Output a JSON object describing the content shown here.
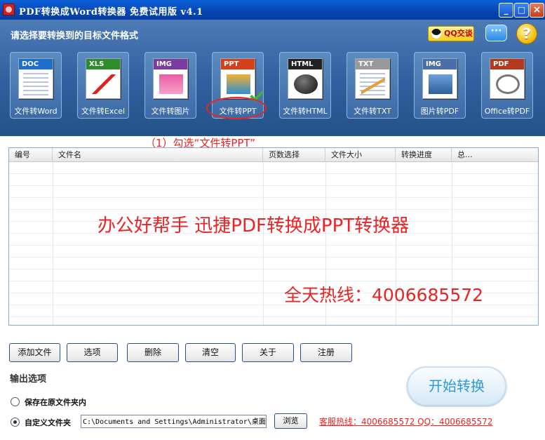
{
  "window": {
    "title": "PDF转换成Word转换器 免费试用版 v4.1",
    "minimize": "_",
    "maximize": "□",
    "close": "×"
  },
  "topbar": {
    "prompt": "请选择要转换到的目标文件格式",
    "qq_label": "QQ交谈",
    "chat_glyph": "···",
    "help_glyph": "?"
  },
  "formats": [
    {
      "tag": "DOC",
      "label": "文件转Word"
    },
    {
      "tag": "XLS",
      "label": "文件转Excel"
    },
    {
      "tag": "IMG",
      "label": "文件转图片"
    },
    {
      "tag": "PPT",
      "label": "文件转PPT"
    },
    {
      "tag": "HTML",
      "label": "文件转HTML"
    },
    {
      "tag": "TXT",
      "label": "文件转TXT"
    },
    {
      "tag": "IMG",
      "label": "图片转PDF"
    },
    {
      "tag": "PDF",
      "label": "Office转PDF"
    }
  ],
  "annotation": "（1）勾选“文件转PPT”",
  "file_list": {
    "columns": [
      "编号",
      "文件名",
      "页数选择",
      "文件大小",
      "转换进度",
      "总..."
    ],
    "watermark": "办公好帮手  迅捷PDF转换成PPT转换器",
    "hotline": "全天热线：4006685572"
  },
  "buttons": {
    "add": "添加文件",
    "options": "选项",
    "delete": "删除",
    "clear": "清空",
    "about": "关于",
    "register": "注册",
    "browse": "浏览",
    "start": "开始转换"
  },
  "output": {
    "title": "输出选项",
    "keep_original": "保存在原文件夹内",
    "custom_folder": "自定义文件夹",
    "path": "C:\\Documents and Settings\\Administrator\\桌面",
    "service_line": "客服热线：4006685572 QQ：4006685572"
  }
}
